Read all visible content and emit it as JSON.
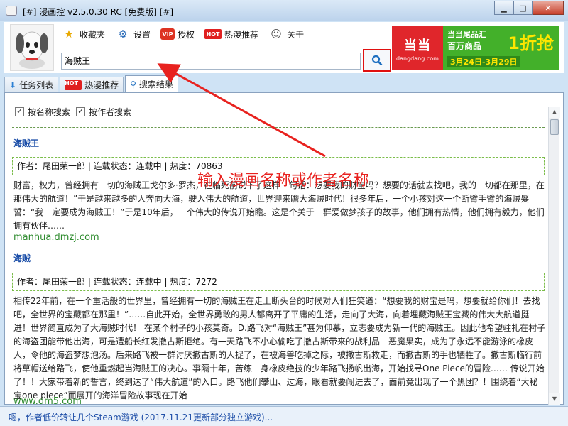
{
  "window": {
    "title": "[#] 漫画控 v2.5.0.30 RC [免费版] [#]",
    "min_label": "▁",
    "max_label": "□",
    "close_label": "✕"
  },
  "toolbar": {
    "favorites": "收藏夹",
    "settings": "设置",
    "license": "授权",
    "hot_recommend": "热漫推荐",
    "about": "关于",
    "vip_badge": "VIP",
    "hot_badge": "HOT"
  },
  "search": {
    "value": "海贼王",
    "button_icon": "search-icon"
  },
  "banner": {
    "logo": "当当",
    "logo_sub": "dangdang.com",
    "line1": "当当尾品汇",
    "line2": "百万商品",
    "big": "1折抢",
    "date": "3月24日-3月29日"
  },
  "tabs": [
    {
      "label": "任务列表"
    },
    {
      "label": "热漫推荐"
    },
    {
      "label": "搜索结果"
    }
  ],
  "filters": {
    "by_name": "按名称搜索",
    "by_author": "按作者搜索",
    "by_name_checked": "✓",
    "by_author_checked": "✓"
  },
  "results": [
    {
      "title": "海贼王",
      "meta": "作者：尾田荣一郎 | 连载状态：连载中 | 热度：70863",
      "desc": "财富，权力，曾经拥有一切的海贼王戈尔多·罗杰，在临死前说下了这样一句话：想要我的财宝吗？想要的话就去找吧，我的一切都在那里，在那伟大的航道！”于是越来越多的人奔向大海，驶入伟大的航道，世界迎来瞻大海贼时代！很多年后，一个小孩对这一个断臂手臂的海贼髮誓：“我一定要成为海贼王！”于是10年后，一个伟大的传说开始瞻。这是个关于一群爱做梦孩子的故事，他们拥有热情，他们拥有毅力，他们拥有伙伴……",
      "source": "manhua.dmzj.com"
    },
    {
      "title": "海贼",
      "meta": "作者：尾田荣一郎 | 连载状态：连载中 | 热度：7272",
      "desc": "相传22年前，在一个重活般的世界里，曾经拥有一切的海贼王在走上断头台的时候对人们狂笑道：“想要我的财宝是吗，想要就给你们！去找吧，全世界的宝藏都在那里！”……自此开始，全世界勇敢的男人都离开了平庸的生活，走向了大海，向着埋藏海贼王宝藏的伟大大航道挺进！世界简直成为了大海贼时代！ 在某个村子的小孩莫奇。D.路飞对“海贼王”甚为仰慕，立志要成为新一代的海贼王。因此他希望驻扎在村子的海盗团能带他出海，可是遭船长红发撤古斯拒绝。有一天路飞不小心偷吃了撤古斯带来的战利品 - 恶魔果实，成为了永远不能游泳的橡皮人，令他的海盗梦想泡汤。后来路飞被一群讨厌撤古斯的人捉了，在被海兽吃掉之际，被撤古斯救走，而撤古斯的手也牺牲了。撤古斯临行前将草帽送给路飞，使他重燃起当海贼王的决心。事隔十年，苦练一身橡皮绝技的少年路飞扬帆出海，开始找寻One Piece的冒险…… 传说开始了！！大家带着新的誓言，终到达了“伟大航道”的入口。路飞他们攀山、过海，眼看就要闯进去了，面前竟出现了一个黑团？！围绕着“大秘宝one piece”而展开的海洋冒险故事现在开始",
      "source": "www.dm5.com"
    }
  ],
  "annotation": "输入漫画名称或作者名称",
  "status": "嗯，作者低价转让几个Steam游戏 (2017.11.21更新部分独立游戏)..."
}
